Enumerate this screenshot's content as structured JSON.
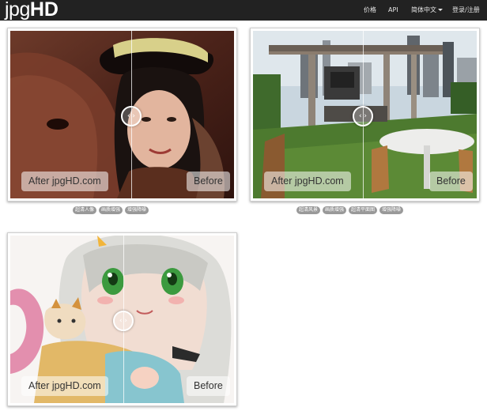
{
  "brand": {
    "logo_light": "jpg",
    "logo_bold": "HD"
  },
  "nav": {
    "pricing": "价格",
    "api": "API",
    "language": "简体中文",
    "login": "登录/注册"
  },
  "colors": {
    "navbar_bg": "#222222",
    "tag_bg": "#999999"
  },
  "handle_glyph": "‹ ›",
  "cards": [
    {
      "subject": "woman-with-horse",
      "after_label": "After jpgHD.com",
      "before_label": "Before",
      "tags": [
        "超清人像",
        "画质增强",
        "增强降噪"
      ]
    },
    {
      "subject": "rooftop-terrace",
      "after_label": "After jpgHD.com",
      "before_label": "Before",
      "tags": [
        "超清风景",
        "画质增强",
        "超清平面图",
        "增强降噪"
      ]
    },
    {
      "subject": "anime-girl",
      "after_label": "After jpgHD.com",
      "before_label": "Before",
      "tags": []
    }
  ]
}
